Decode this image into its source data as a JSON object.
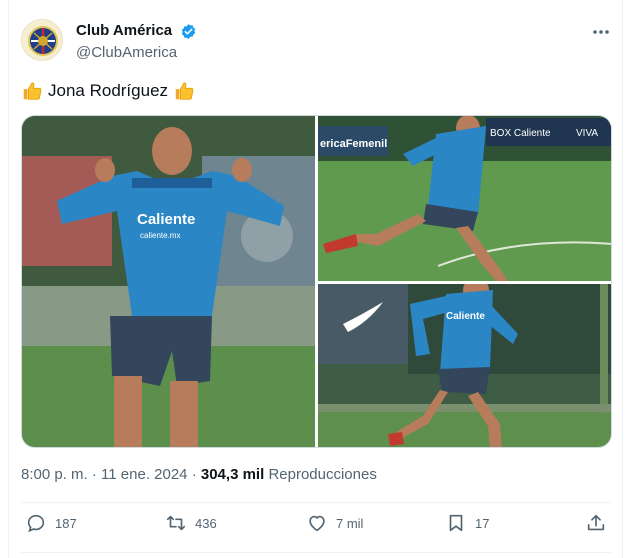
{
  "author": {
    "display_name": "Club América",
    "handle": "@ClubAmerica",
    "avatar_icon": "club-america-crest",
    "verified_icon": "verified-badge-icon",
    "verified_color": "#1d9bf0"
  },
  "menu_icon": "more-options-icon",
  "tweet": {
    "text": "Jona Rodríguez",
    "emoji_icon": "thumbs-up-icon"
  },
  "media": {
    "photo_count": 3,
    "photos": [
      {
        "name": "player-thumbs-up"
      },
      {
        "name": "player-running"
      },
      {
        "name": "player-kicking"
      }
    ]
  },
  "meta": {
    "time": "8:00 p. m.",
    "separator": "·",
    "date": "11 ene. 2024",
    "views": "304,3 mil",
    "views_label": "Reproducciones"
  },
  "actions": {
    "replies": "187",
    "retweets": "436",
    "likes": "7 mil",
    "bookmarks": "17"
  },
  "colors": {
    "text": "#0f1419",
    "secondary": "#536471",
    "border": "#cfd9de",
    "jersey": "#2b86c5"
  }
}
